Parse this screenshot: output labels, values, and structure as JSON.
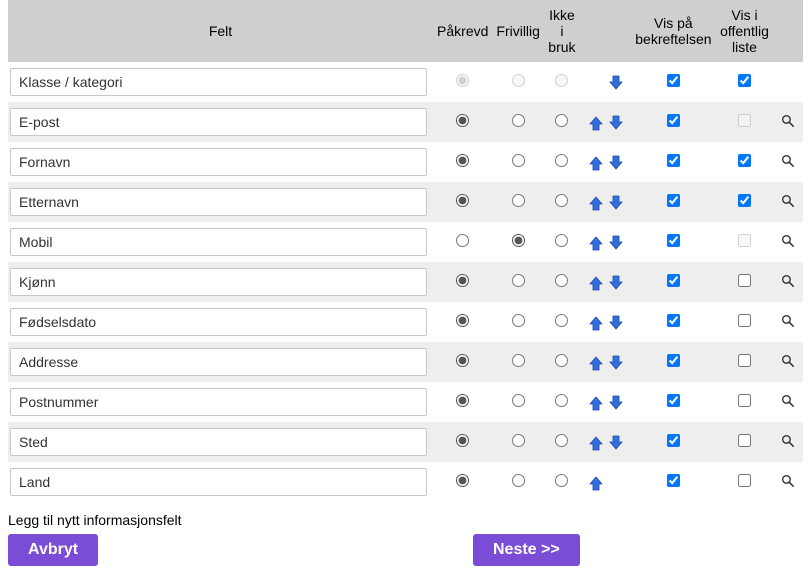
{
  "headers": {
    "felt": "Felt",
    "pakrevd": "Påkrevd",
    "frivillig": "Frivillig",
    "ikke_i_bruk": "Ikke i bruk",
    "vis_bekreftelsen": "Vis på bekreftelsen",
    "vis_offentlig": "Vis i offentlig liste"
  },
  "rows": [
    {
      "name": "Klasse / kategori",
      "radio_state": "pakrevd",
      "radios_disabled": true,
      "has_up": false,
      "has_down": true,
      "bekreftelsen": true,
      "bekreftelsen_disabled": false,
      "offentlig": true,
      "offentlig_disabled": false,
      "has_search": false
    },
    {
      "name": "E-post",
      "radio_state": "pakrevd",
      "radios_disabled": false,
      "has_up": true,
      "has_down": true,
      "bekreftelsen": true,
      "bekreftelsen_disabled": false,
      "offentlig": false,
      "offentlig_disabled": true,
      "has_search": true
    },
    {
      "name": "Fornavn",
      "radio_state": "pakrevd",
      "radios_disabled": false,
      "has_up": true,
      "has_down": true,
      "bekreftelsen": true,
      "bekreftelsen_disabled": false,
      "offentlig": true,
      "offentlig_disabled": false,
      "has_search": true
    },
    {
      "name": "Etternavn",
      "radio_state": "pakrevd",
      "radios_disabled": false,
      "has_up": true,
      "has_down": true,
      "bekreftelsen": true,
      "bekreftelsen_disabled": false,
      "offentlig": true,
      "offentlig_disabled": false,
      "has_search": true
    },
    {
      "name": "Mobil",
      "radio_state": "frivillig",
      "radios_disabled": false,
      "has_up": true,
      "has_down": true,
      "bekreftelsen": true,
      "bekreftelsen_disabled": false,
      "offentlig": false,
      "offentlig_disabled": true,
      "has_search": true
    },
    {
      "name": "Kjønn",
      "radio_state": "pakrevd",
      "radios_disabled": false,
      "has_up": true,
      "has_down": true,
      "bekreftelsen": true,
      "bekreftelsen_disabled": false,
      "offentlig": false,
      "offentlig_disabled": false,
      "has_search": true
    },
    {
      "name": "Fødselsdato",
      "radio_state": "pakrevd",
      "radios_disabled": false,
      "has_up": true,
      "has_down": true,
      "bekreftelsen": true,
      "bekreftelsen_disabled": false,
      "offentlig": false,
      "offentlig_disabled": false,
      "has_search": true
    },
    {
      "name": "Addresse",
      "radio_state": "pakrevd",
      "radios_disabled": false,
      "has_up": true,
      "has_down": true,
      "bekreftelsen": true,
      "bekreftelsen_disabled": false,
      "offentlig": false,
      "offentlig_disabled": false,
      "has_search": true
    },
    {
      "name": "Postnummer",
      "radio_state": "pakrevd",
      "radios_disabled": false,
      "has_up": true,
      "has_down": true,
      "bekreftelsen": true,
      "bekreftelsen_disabled": false,
      "offentlig": false,
      "offentlig_disabled": false,
      "has_search": true
    },
    {
      "name": "Sted",
      "radio_state": "pakrevd",
      "radios_disabled": false,
      "has_up": true,
      "has_down": true,
      "bekreftelsen": true,
      "bekreftelsen_disabled": false,
      "offentlig": false,
      "offentlig_disabled": false,
      "has_search": true
    },
    {
      "name": "Land",
      "radio_state": "pakrevd",
      "radios_disabled": false,
      "has_up": true,
      "has_down": false,
      "bekreftelsen": true,
      "bekreftelsen_disabled": false,
      "offentlig": false,
      "offentlig_disabled": false,
      "has_search": true
    }
  ],
  "footer": {
    "add_field": "Legg til nytt informasjonsfelt",
    "cancel": "Avbryt",
    "next": "Neste >>"
  }
}
